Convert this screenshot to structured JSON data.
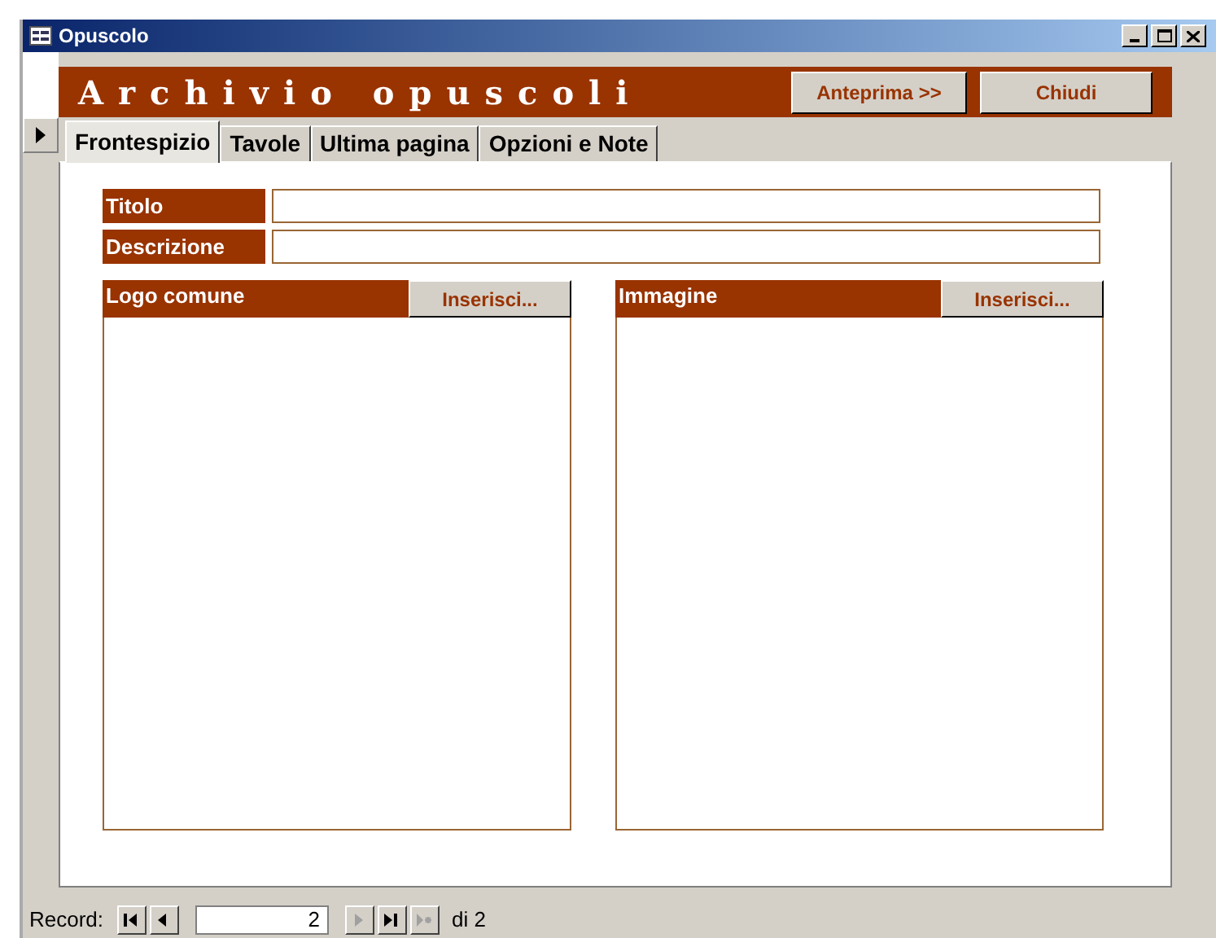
{
  "window": {
    "title": "Opuscolo"
  },
  "header": {
    "title": "Archivio opuscoli",
    "buttons": [
      "Anteprima >>",
      "Chiudi"
    ]
  },
  "tabs": [
    {
      "label": "Frontespizio",
      "selected": true
    },
    {
      "label": "Tavole",
      "selected": false
    },
    {
      "label": "Ultima pagina",
      "selected": false
    },
    {
      "label": "Opzioni e Note",
      "selected": false
    }
  ],
  "fields": [
    {
      "label": "Titolo"
    },
    {
      "label": "Descrizione"
    }
  ],
  "image_panels": [
    {
      "label": "Logo comune",
      "button": "Inserisci..."
    },
    {
      "label": "Immagine",
      "button": "Inserisci..."
    }
  ],
  "navigation": {
    "label": "Record:",
    "current": "2",
    "total": "di 2",
    "buttons": [
      {
        "kind": "first",
        "disabled": false
      },
      {
        "kind": "prev",
        "disabled": false
      },
      {
        "kind": "next",
        "disabled": true
      },
      {
        "kind": "last",
        "disabled": false
      },
      {
        "kind": "new",
        "disabled": true
      }
    ]
  }
}
